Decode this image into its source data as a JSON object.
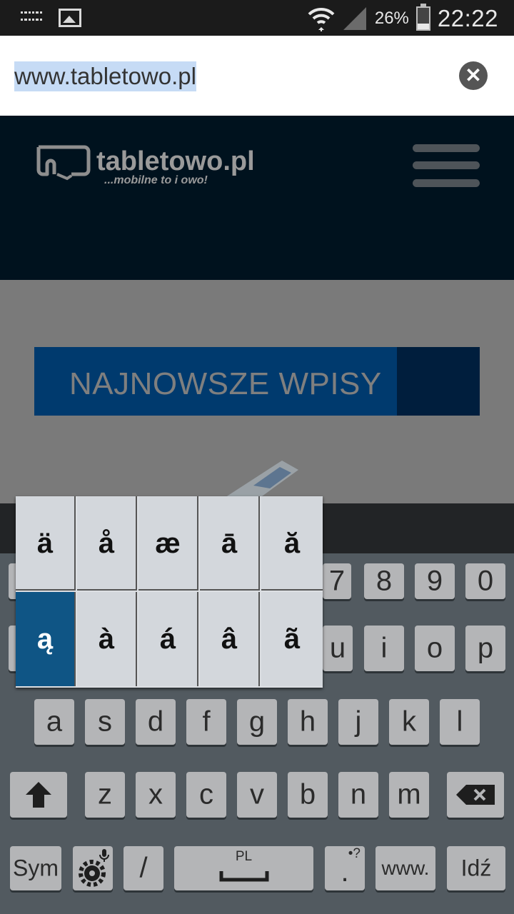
{
  "status_bar": {
    "battery_percent": "26%",
    "time": "22:22",
    "battery_level": 0.26
  },
  "url_bar": {
    "url": "www.tabletowo.pl"
  },
  "site": {
    "logo_name": "tabletowo.pl",
    "logo_tagline": "...mobilne to i owo!",
    "banner_text": "NAJNOWSZE WPISY"
  },
  "accent_popup": {
    "selected": "ą",
    "chars": [
      "ä",
      "å",
      "æ",
      "ā",
      "ă",
      "ą",
      "à",
      "á",
      "â",
      "ã"
    ]
  },
  "keyboard": {
    "number_row_visible": [
      "7",
      "8",
      "9",
      "0"
    ],
    "top_row_visible": [
      "u",
      "i",
      "o",
      "p"
    ],
    "home_row": [
      "a",
      "s",
      "d",
      "f",
      "g",
      "h",
      "j",
      "k",
      "l"
    ],
    "bottom_row": [
      "z",
      "x",
      "c",
      "v",
      "b",
      "n",
      "m"
    ],
    "sym_label": "Sym",
    "slash_label": "/",
    "space_label": "PL",
    "period_label": ".",
    "period_hint": "•?",
    "www_label": "www.",
    "go_label": "Idź"
  },
  "icons": [
    "keyboard-icon",
    "image-icon",
    "wifi-icon",
    "signal-icon",
    "battery-icon",
    "clear-icon",
    "hamburger-icon",
    "shift-icon",
    "backspace-icon",
    "settings-icon",
    "mic-icon"
  ]
}
